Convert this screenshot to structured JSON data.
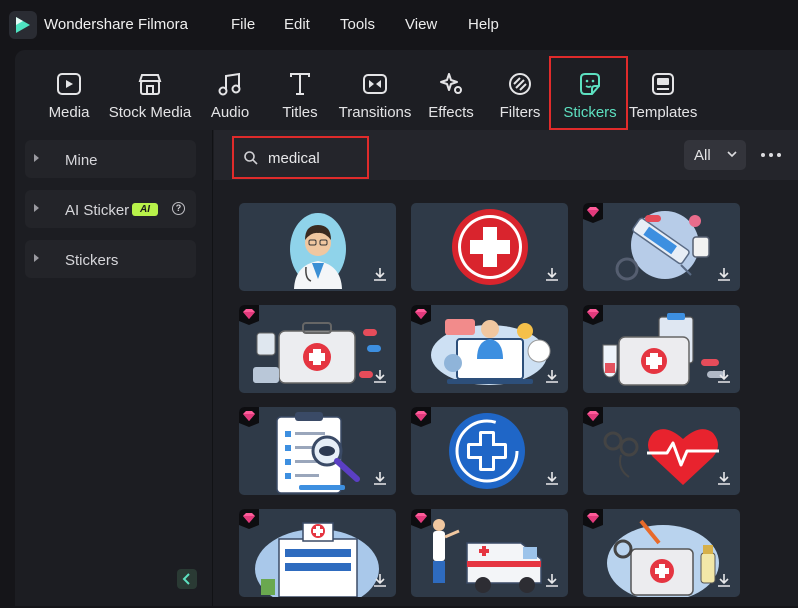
{
  "app": {
    "name": "Wondershare Filmora"
  },
  "menu": [
    "File",
    "Edit",
    "Tools",
    "View",
    "Help"
  ],
  "toolbar": {
    "tabs": [
      {
        "label": "Media",
        "icon": "media-icon"
      },
      {
        "label": "Stock Media",
        "icon": "stock-media-icon"
      },
      {
        "label": "Audio",
        "icon": "music-note-icon"
      },
      {
        "label": "Titles",
        "icon": "text-t-icon"
      },
      {
        "label": "Transitions",
        "icon": "transitions-icon"
      },
      {
        "label": "Effects",
        "icon": "sparkle-icon"
      },
      {
        "label": "Filters",
        "icon": "filter-icon"
      },
      {
        "label": "Stickers",
        "icon": "sticker-icon",
        "active": true
      },
      {
        "label": "Templates",
        "icon": "templates-icon"
      }
    ],
    "accent": "#5de0c0"
  },
  "sidebar": {
    "items": [
      {
        "label": "Mine"
      },
      {
        "label": "AI Sticker",
        "badge": "AI"
      },
      {
        "label": "Stickers"
      }
    ]
  },
  "search": {
    "value": "medical",
    "placeholder": ""
  },
  "filter": {
    "selected": "All"
  },
  "stickers": [
    {
      "name": "doctor-avatar",
      "premium": false
    },
    {
      "name": "red-cross-circle",
      "premium": false
    },
    {
      "name": "syringe-pills",
      "premium": true
    },
    {
      "name": "first-aid-kit-pills",
      "premium": true
    },
    {
      "name": "online-doctor",
      "premium": true
    },
    {
      "name": "medical-kit-clipboard",
      "premium": true
    },
    {
      "name": "checklist-magnifier",
      "premium": true
    },
    {
      "name": "blue-cross-circle",
      "premium": true
    },
    {
      "name": "heartbeat-stethoscope",
      "premium": true
    },
    {
      "name": "hospital-building",
      "premium": true
    },
    {
      "name": "ambulance-doctor",
      "premium": true
    },
    {
      "name": "medical-bag-bottles",
      "premium": true
    }
  ]
}
